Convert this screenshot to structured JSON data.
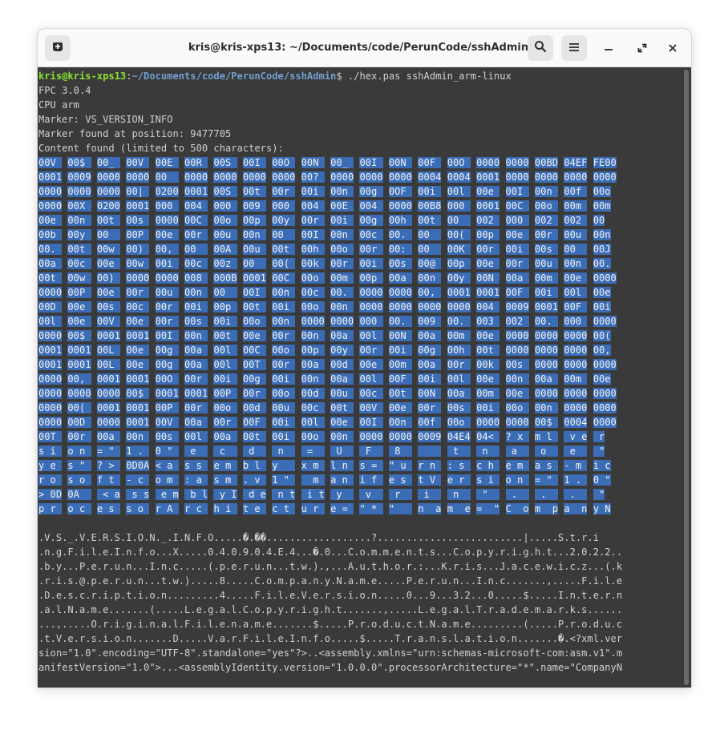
{
  "window": {
    "title": "kris@kris-xps13: ~/Documents/code/PerunCode/sshAdmin",
    "buttons": {
      "new_tab_icon": "new-tab-icon",
      "search_icon": "search-icon",
      "menu_icon": "hamburger-menu-icon",
      "minimize_icon": "minimize-icon",
      "maximize_icon": "maximize-icon",
      "close_icon": "close-icon"
    }
  },
  "colors": {
    "terminal_bg": "#3a3a3a",
    "selection": "#3b6db7",
    "prompt_user": "#8ae234",
    "prompt_path": "#729fcf"
  },
  "terminal": {
    "prompt": {
      "user": "kris@kris-xps13",
      "sep": ":",
      "path": "~/Documents/code/PerunCode/sshAdmin",
      "symbol": "$",
      "command": " ./hex.pas sshAdmin_arm-linux"
    },
    "output": [
      "FPC 3.0.4",
      "CPU arm",
      "Marker: VS_VERSION_INFO",
      "Marker found at position: 9477705",
      "Content found (limited to 500 characters):"
    ],
    "hex": [
      "00V  00$  00_  00V  00E  00R  00S  00I  00O  00N  00_  00I  00N  00F  00O  0000 0000 00BD 04EF FE00",
      "0001 0009 0000 0000 00   0000 0000 0000 0000 00?  0000 0000 0000 0004 0004 0001 0000 0000 0000 0000",
      "0000 0000 0000 00|  0200 0001 00S  00t  00r  00i  00n  00g  0OF  00i  00l  00e  00I  00n  00f  00o",
      "0000 00X  0200 0001 000  004  000  009  000  004  00E  004  0000 00B8 000  0001 00C  00o  00m  00m",
      "00e  00n  00t  00s  0000 00C  00o  00p  00y  00r  00i  00g  00h  00t  00   002  000  002  002  00",
      "00b  00y  00   00P  00e  00r  00u  00n  00   00I  00n  00c  00.  00   00(  00p  00e  00r  00u  00n",
      "00.  00t  00w  00)  00,  00   00A  00u  00t  00h  00o  00r  00:  00   00K  00r  00i  00s  00   00J",
      "00a  00c  00e  00w  00i  00c  00z  00   00(  00k  00r  00i  00s  00@  00p  00e  00r  00u  00n  00.",
      "00t  00w  00)  0000 0000 008  000B 0001 00C  00o  00m  00p  00a  00n  00y  00N  00a  00m  00e  0000",
      "0000 00P  00e  00r  00u  00n  00   00I  00n  00c  00.  0000 0000 00,  0001 0001 00F  00i  00l  00e",
      "00D  00e  00s  00c  00r  00i  00p  00t  00i  00o  00n  0000 0000 0000 0000 004  0009 0001 00F  00i",
      "00l  00e  00V  00e  00r  00s  00i  00o  00n  0000 0000 000  00.  009  00.  003  002  00.  000  0000",
      "0000 00$  0001 0001 00I  00n  00t  00e  00r  00n  00a  00l  00N  00a  00m  00e  0000 0000 0000 00(",
      "0001 0001 00L  00e  00g  00a  00l  00C  00o  00p  00y  00r  00i  00g  00h  00t  0000 0000 0000 00,",
      "0001 0001 00L  00e  00g  00a  00l  00T  00r  00a  00d  00e  00m  00a  00r  00k  00s  0000 0000 0000",
      "0000 00,  0001 0001 00O  00r  00i  00g  00i  00n  00a  00l  00F  00i  00l  00e  00n  00a  00m  00e",
      "0000 0000 0000 00$  0001 0001 00P  00r  00o  00d  00u  00c  00t  00N  00a  00m  00e  0000 0000 0000",
      "0000 00(  0001 0001 00P  00r  00o  00d  00u  00c  00t  00V  00e  00r  00s  00i  00o  00n  0000 0000",
      "0000 00D  0000 0001 00V  00a  00r  00F  00i  00l  00e  00I  00n  00f  00o  0000 0000 00$  0004 0000",
      "00T  00r  00a  00n  00s  00l  00a  00t  00i  00o  00n  0000 0000 0009 04E4 04<  ? x  m l   v e  r",
      "s i  o n  = \"  1 .  0 \"   e  n c  o d  i n  g =  \" U  T F  - 8  \"    s t  a n  d a  l o  n e  = \"",
      "y e  s \"  ? >  0D0A < a  s s  e m  b l  y    x m  l n  s =  \" u  r n  : s  c h  e m  a s  - m  i c",
      "r o  s o  f t  - c  o m  : a  s m  . v  1 \"    m  a n  i f  e s  t V  e r  s i  o n  = \"  1 .  0 \"",
      "> 0D 0A    < a  s s  e m  b l  y I  d e  n t  i t  y    v  e r  s i  o n  = \"  1 .  0 .  0 .  0 \"",
      "p r  o c  e s  s o  r A  r c  h i  t e  c t  u r  e =  \" *  \"    n  a m  e =  \" C  o m  p a  n y N"
    ],
    "ascii": [
      ".V.S._.V.E.R.S.I.O.N._.I.N.F.O.....�.��..................?.........................|.....S.t.r.i",
      ".n.g.F.i.l.e.I.n.f.o...X.....0.4.0.9.0.4.E.4...�.0...C.o.m.m.e.n.t.s...C.o.p.y.r.i.g.h.t...2.0.2.2..",
      ".b.y...P.e.r.u.n...I.n.c.....(.p.e.r.u.n...t.w.).,...A.u.t.h.o.r.:...K.r.i.s...J.a.c.e.w.i.c.z...(.k",
      ".r.i.s.@.p.e.r.u.n...t.w.).....8.....C.o.m.p.a.n.y.N.a.m.e.....P.e.r.u.n...I.n.c.......,.....F.i.l.e",
      ".D.e.s.c.r.i.p.t.i.o.n.........4.....F.i.l.e.V.e.r.s.i.o.n.....0...9...3.2...0.....$.....I.n.t.e.r.n",
      ".a.l.N.a.m.e.......(.....L.e.g.a.l.C.o.p.y.r.i.g.h.t.......,.....L.e.g.a.l.T.r.a.d.e.m.a.r.k.s......",
      "...,.....O.r.i.g.i.n.a.l.F.i.l.e.n.a.m.e.......$.....P.r.o.d.u.c.t.N.a.m.e.........(.....P.r.o.d.u.c",
      ".t.V.e.r.s.i.o.n.......D.....V.a.r.F.i.l.e.I.n.f.o.....$.....T.r.a.n.s.l.a.t.i.o.n.......�.<?xml.ver",
      "sion=\"1.0\".encoding=\"UTF-8\".standalone=\"yes\"?>..<assembly.xmlns=\"urn:schemas-microsoft-com:asm.v1\".m",
      "anifestVersion=\"1.0\">...<assemblyIdentity.version=\"1.0.0.0\".processorArchitecture=\"*\".name=\"CompanyN"
    ]
  }
}
